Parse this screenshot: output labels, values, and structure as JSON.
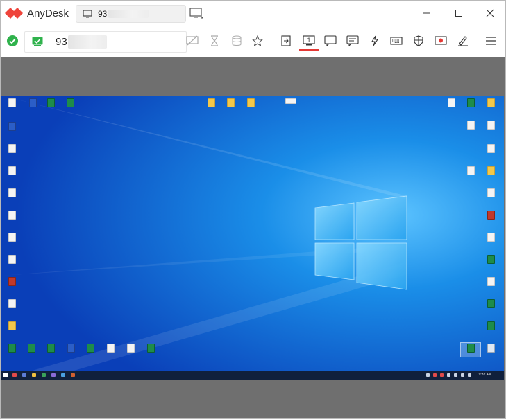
{
  "app": {
    "title": "AnyDesk",
    "session_tab_id": "93",
    "address_id": "93",
    "colors": {
      "brand": "#ef443b",
      "accent_active": "#e53935",
      "ok_green": "#2fb24c"
    }
  },
  "titlebar": {
    "new_tab_icon": "monitor-plus-icon",
    "controls": [
      "minimize-icon",
      "maximize-icon",
      "close-icon"
    ]
  },
  "toolbar": {
    "status_icon": "check-circle-icon",
    "connection_icon": "verified-shield-icon",
    "icons": [
      "hide-screen-icon",
      "hourglass-icon",
      "database-icon",
      "star-icon",
      "transfer-icon",
      "monitor-1-icon",
      "chat-bubble-icon",
      "message-icon",
      "lightning-icon",
      "keyboard-icon",
      "shield-icon",
      "record-icon",
      "pen-icon",
      "menu-icon"
    ],
    "active_monitor_label": "1"
  },
  "remote_desktop": {
    "taskbar_time": "9:32 AM"
  }
}
